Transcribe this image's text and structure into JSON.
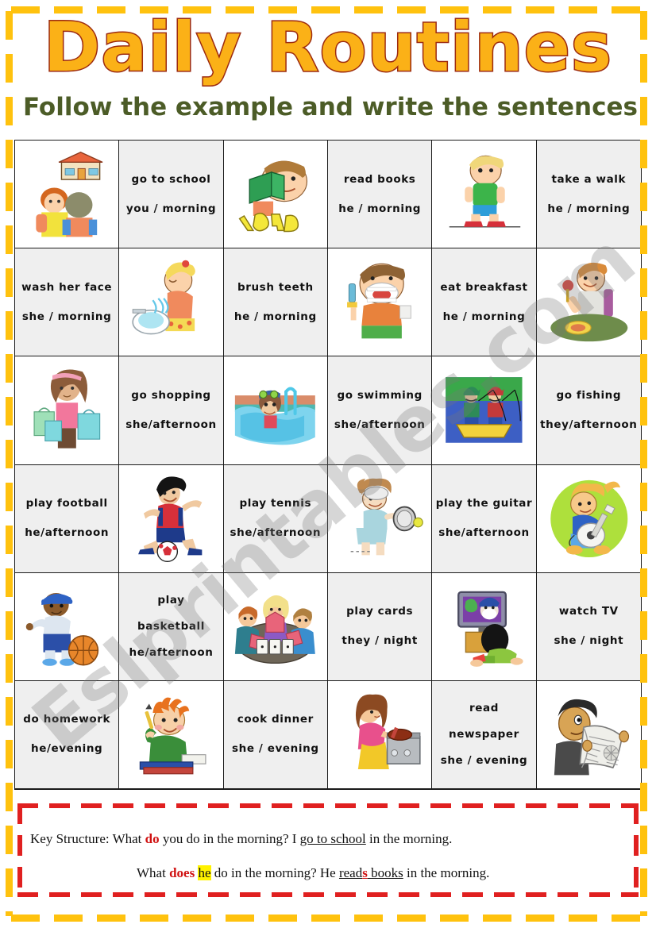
{
  "header": {
    "title": "Daily Routines",
    "subtitle": "Follow the example and write the sentences",
    "title_fill": "#FBB117",
    "title_outline": "#9C2A10",
    "subtitle_color": "#4C5C27",
    "frame_color": "#FFC20E"
  },
  "watermark": {
    "text": "Eslprintables.com"
  },
  "grid": {
    "rows": 6,
    "cols": 6,
    "cells": [
      {
        "kind": "image",
        "icon": "two-students-school-icon",
        "shade": false,
        "alt": "two children in front of a school building"
      },
      {
        "kind": "text",
        "shade": true,
        "line1": "go to school",
        "line2": "you / morning"
      },
      {
        "kind": "image",
        "icon": "boy-reading-book-icon",
        "shade": false,
        "alt": "boy reading a green book with READ letters"
      },
      {
        "kind": "text",
        "shade": true,
        "line1": "read books",
        "line2": "he / morning"
      },
      {
        "kind": "image",
        "icon": "boy-walking-icon",
        "shade": false,
        "alt": "boy walking in green shirt and blue shorts"
      },
      {
        "kind": "text",
        "shade": true,
        "line1": "take a walk",
        "line2": "he / morning"
      },
      {
        "kind": "text",
        "shade": true,
        "line1": "wash her face",
        "line2": "she / morning"
      },
      {
        "kind": "image",
        "icon": "girl-washing-face-icon",
        "shade": false,
        "alt": "girl washing her face at a sink"
      },
      {
        "kind": "text",
        "shade": true,
        "line1": "brush teeth",
        "line2": "he / morning"
      },
      {
        "kind": "image",
        "icon": "boy-brushing-teeth-icon",
        "shade": false,
        "alt": "boy brushing his teeth with foam"
      },
      {
        "kind": "text",
        "shade": true,
        "line1": "eat breakfast",
        "line2": "he / morning"
      },
      {
        "kind": "image",
        "icon": "boy-eating-breakfast-icon",
        "shade": false,
        "alt": "boy eating at a table with a spoon"
      },
      {
        "kind": "image",
        "icon": "girl-shopping-bags-icon",
        "shade": false,
        "alt": "girl holding shopping bags"
      },
      {
        "kind": "text",
        "shade": true,
        "line1": "go shopping",
        "line2": "she/afternoon"
      },
      {
        "kind": "image",
        "icon": "girl-swimming-pool-icon",
        "shade": false,
        "alt": "girl swimming in a pool with goggles"
      },
      {
        "kind": "text",
        "shade": true,
        "line1": "go swimming",
        "line2": "she/afternoon"
      },
      {
        "kind": "image",
        "icon": "two-men-fishing-boat-icon",
        "shade": false,
        "alt": "two men fishing from a yellow boat"
      },
      {
        "kind": "text",
        "shade": true,
        "line1": "go fishing",
        "line2": "they/afternoon"
      },
      {
        "kind": "text",
        "shade": true,
        "line1": "play football",
        "line2": "he/afternoon"
      },
      {
        "kind": "image",
        "icon": "boy-playing-football-icon",
        "shade": false,
        "alt": "boy kicking a soccer ball"
      },
      {
        "kind": "text",
        "shade": true,
        "line1": "play tennis",
        "line2": "she/afternoon"
      },
      {
        "kind": "image",
        "icon": "person-playing-tennis-icon",
        "shade": false,
        "alt": "person swinging a tennis racket"
      },
      {
        "kind": "text",
        "shade": true,
        "line1": "play the guitar",
        "line2": "she/afternoon"
      },
      {
        "kind": "image",
        "icon": "kid-playing-guitar-icon",
        "shade": false,
        "alt": "kid playing guitar on a green circle"
      },
      {
        "kind": "image",
        "icon": "boy-playing-basketball-icon",
        "shade": false,
        "alt": "boy dribbling a basketball"
      },
      {
        "kind": "text3",
        "shade": true,
        "line1": "play",
        "line2": "basketball",
        "line3": "he/afternoon"
      },
      {
        "kind": "image",
        "icon": "people-playing-cards-icon",
        "shade": false,
        "alt": "three people playing cards at a table"
      },
      {
        "kind": "text",
        "shade": true,
        "line1": "play cards",
        "line2": "they / night"
      },
      {
        "kind": "image",
        "icon": "girl-watching-tv-icon",
        "shade": false,
        "alt": "girl lying on floor watching television"
      },
      {
        "kind": "text",
        "shade": true,
        "line1": "watch TV",
        "line2": "she / night"
      },
      {
        "kind": "text",
        "shade": true,
        "line1": "do homework",
        "line2": "he/evening"
      },
      {
        "kind": "image",
        "icon": "boy-doing-homework-icon",
        "shade": false,
        "alt": "boy with pencil studying over books"
      },
      {
        "kind": "text",
        "shade": true,
        "line1": "cook dinner",
        "line2": "she / evening"
      },
      {
        "kind": "image",
        "icon": "woman-cooking-icon",
        "shade": false,
        "alt": "woman cooking at a stove"
      },
      {
        "kind": "text3",
        "shade": true,
        "line1": "read",
        "line2": "newspaper",
        "line3": "she / evening"
      },
      {
        "kind": "image",
        "icon": "man-reading-newspaper-icon",
        "shade": false,
        "alt": "man reading a newspaper"
      }
    ]
  },
  "key_structure": {
    "label": "Key Structure:",
    "line1": {
      "pre": "What ",
      "red": "do",
      "mid": " you do in the morning? I ",
      "underline": "go to school",
      "post": " in the morning."
    },
    "line2": {
      "pre": "What ",
      "red": "does",
      "highlight": "he",
      "mid": " do in the morning? He ",
      "underline_a": "read",
      "underline_red_s": "s",
      "underline_b": " books",
      "post": " in the morning."
    },
    "border_color": "#E02020",
    "accent_color": "#D01212",
    "highlight_color": "#FFF200"
  }
}
